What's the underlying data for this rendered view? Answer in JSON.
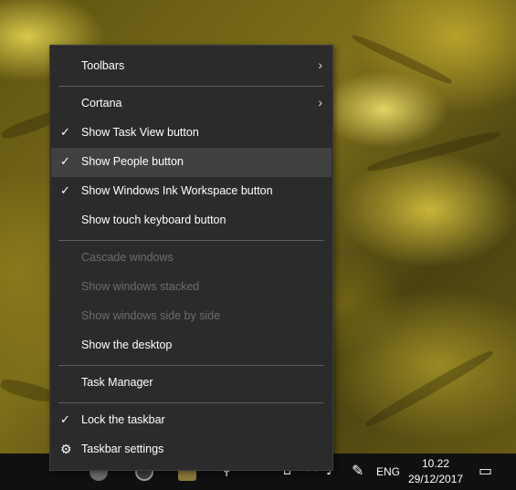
{
  "menu": {
    "items": [
      {
        "label": "Toolbars",
        "checked": false,
        "submenu": true,
        "enabled": true
      },
      {
        "label": "Cortana",
        "checked": false,
        "submenu": true,
        "enabled": true
      },
      {
        "label": "Show Task View button",
        "checked": true,
        "submenu": false,
        "enabled": true
      },
      {
        "label": "Show People button",
        "checked": true,
        "submenu": false,
        "enabled": true,
        "highlighted": true
      },
      {
        "label": "Show Windows Ink Workspace button",
        "checked": true,
        "submenu": false,
        "enabled": true
      },
      {
        "label": "Show touch keyboard button",
        "checked": false,
        "submenu": false,
        "enabled": true
      },
      {
        "label": "Cascade windows",
        "checked": false,
        "submenu": false,
        "enabled": false
      },
      {
        "label": "Show windows stacked",
        "checked": false,
        "submenu": false,
        "enabled": false
      },
      {
        "label": "Show windows side by side",
        "checked": false,
        "submenu": false,
        "enabled": false
      },
      {
        "label": "Show the desktop",
        "checked": false,
        "submenu": false,
        "enabled": true
      },
      {
        "label": "Task Manager",
        "checked": false,
        "submenu": false,
        "enabled": true
      },
      {
        "label": "Lock the taskbar",
        "checked": true,
        "submenu": false,
        "enabled": true
      },
      {
        "label": "Taskbar settings",
        "checked": false,
        "submenu": false,
        "enabled": true,
        "icon": "gear-icon"
      }
    ]
  },
  "taskbar": {
    "language": "ENG",
    "time": "10.22",
    "date": "29/12/2017"
  },
  "icons": {
    "check": "✓",
    "submenu_arrow": "›",
    "gear": "⚙"
  },
  "colors": {
    "menu_bg": "#2b2b2b",
    "menu_highlight": "#414141",
    "menu_disabled_text": "#6d6d6d",
    "taskbar_bg": "#101010"
  }
}
